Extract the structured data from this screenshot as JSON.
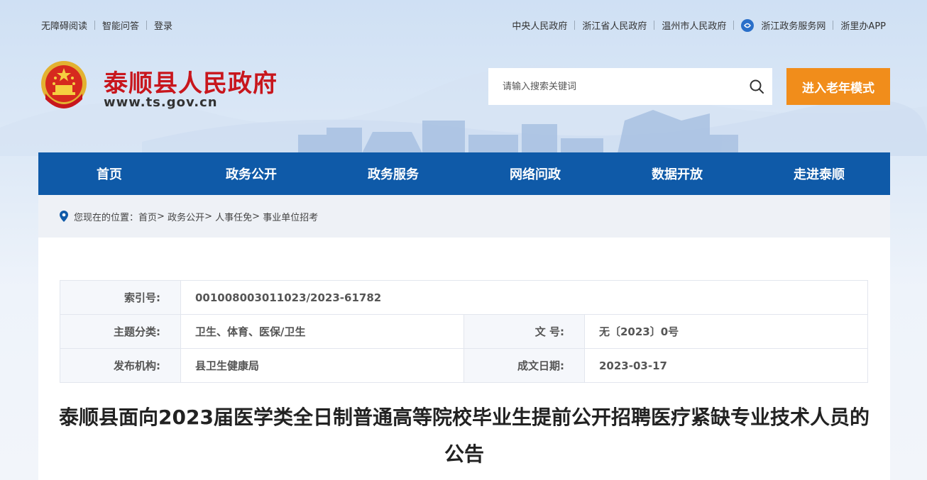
{
  "topbar": {
    "left_links": [
      "无障碍阅读",
      "智能问答",
      "登录"
    ],
    "right_links": [
      "中央人民政府",
      "浙江省人民政府",
      "温州市人民政府",
      "浙江政务服务网",
      "浙里办APP"
    ]
  },
  "header": {
    "site_title": "泰顺县人民政府",
    "site_url": "www.ts.gov.cn",
    "search_placeholder": "请输入搜索关键词",
    "elder_mode_label": "进入老年模式"
  },
  "nav": {
    "items": [
      "首页",
      "政务公开",
      "政务服务",
      "网络问政",
      "数据开放",
      "走进泰顺"
    ]
  },
  "breadcrumb": {
    "prefix": "您现在的位置：",
    "items": [
      "首页",
      "政务公开",
      "人事任免",
      "事业单位招考"
    ],
    "separator": ">"
  },
  "meta": {
    "index_label": "索引号:",
    "index_value": "001008003011023/2023-61782",
    "topic_label": "主题分类:",
    "topic_value": "卫生、体育、医保/卫生",
    "docno_label": "文 号:",
    "docno_value": "无〔2023〕0号",
    "publisher_label": "发布机构:",
    "publisher_value": "县卫生健康局",
    "date_label": "成文日期:",
    "date_value": "2023-03-17"
  },
  "article": {
    "title": "泰顺县面向2023届医学类全日制普通高等院校毕业生提前公开招聘医疗紧缺专业技术人员的公告"
  },
  "colors": {
    "brand_red": "#c8161d",
    "nav_blue": "#0f5aa8",
    "elder_orange": "#f18d1b"
  }
}
